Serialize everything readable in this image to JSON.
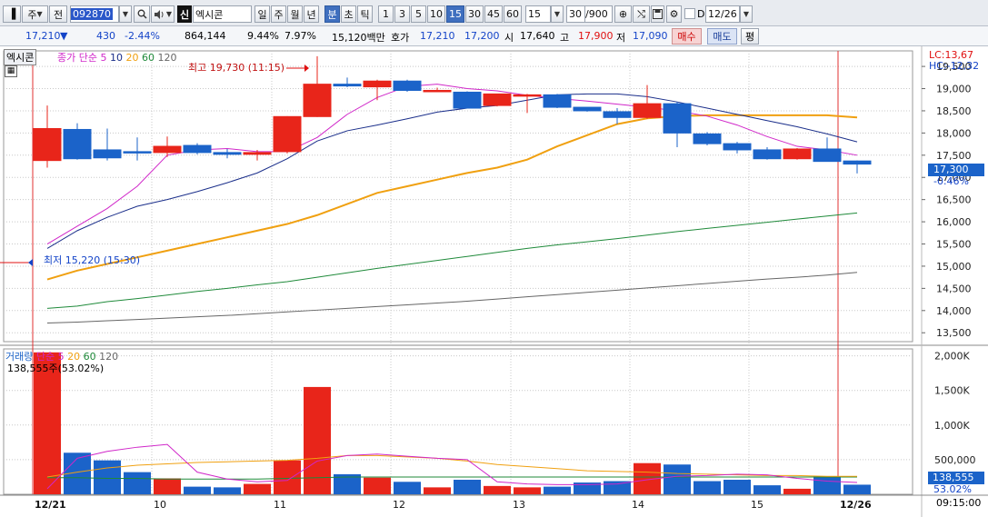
{
  "toolbar": {
    "market": "주",
    "segment": "전",
    "code": "092870",
    "credit_badge": "신",
    "name": "엑시콘",
    "periods": [
      "일",
      "주",
      "월",
      "년",
      "분",
      "초",
      "틱"
    ],
    "active_period": "분",
    "intervals": [
      "1",
      "3",
      "5",
      "10",
      "15",
      "30",
      "45",
      "60"
    ],
    "active_interval": "15",
    "interval_value": "15",
    "count": "30",
    "count_total": "/900",
    "date_check": "D",
    "date": "12/26"
  },
  "quote": {
    "price": "17,210",
    "arrow": "▼",
    "change": "430",
    "change_pct": "-2.44%",
    "volume": "864,144",
    "pct1": "9.44%",
    "pct2": "7.97%",
    "amount": "15,120백만",
    "ask_label": "호가",
    "ask": "17,210",
    "bid": "17,200",
    "open_label": "시",
    "open": "17,640",
    "high_label": "고",
    "high": "17,900",
    "low_label": "저",
    "low": "17,090",
    "buy_label": "매수",
    "sell_label": "매도",
    "flat_label": "평"
  },
  "price_panel": {
    "title": "엑시콘",
    "ma_label": "종가 단순",
    "ma_periods": [
      "5",
      "10",
      "20",
      "60",
      "120"
    ],
    "lc": "LC:13,67",
    "hc": "HC:-12,32",
    "high_note": "최고 19,730 (11:15)",
    "low_note": "최저 15,220 (15:30)",
    "current_price": "17,300",
    "current_pct": "-0.46%",
    "y_ticks": [
      "19,500",
      "19,000",
      "18,500",
      "18,000",
      "17,500",
      "17,000",
      "16,500",
      "16,000",
      "15,500",
      "15,000",
      "14,500",
      "14,000",
      "13,500"
    ]
  },
  "volume_panel": {
    "title": "거래량",
    "ma_label": "단순",
    "ma_periods": [
      "5",
      "20",
      "60",
      "120"
    ],
    "info": "138,555주(53.02%)",
    "y_ticks": [
      "2,000K",
      "1,500K",
      "1,000K",
      "500,000"
    ],
    "current_volume": "138,555",
    "current_pct": "53.02%"
  },
  "x_axis": {
    "labels": [
      "12/21",
      "10",
      "11",
      "12",
      "13",
      "14",
      "15",
      "12/26"
    ],
    "time": "09:15:00"
  },
  "colors": {
    "up": "#e8251a",
    "down": "#1b63c9",
    "ma5": "#d027c9",
    "ma10": "#1a2e8a",
    "ma20": "#f0a010",
    "ma60": "#1f8a3a",
    "ma120": "#666666"
  },
  "chart_data": {
    "type": "candlestick",
    "y_range": [
      13300,
      19850
    ],
    "volume_range": [
      0,
      2100000
    ],
    "candles": [
      {
        "o": 17380,
        "h": 18620,
        "l": 17220,
        "c": 18100,
        "v": 2050000
      },
      {
        "o": 18080,
        "h": 18220,
        "l": 17400,
        "c": 17420,
        "v": 600000
      },
      {
        "o": 17620,
        "h": 18100,
        "l": 17380,
        "c": 17440,
        "v": 490000
      },
      {
        "o": 17580,
        "h": 17900,
        "l": 17380,
        "c": 17560,
        "v": 320000
      },
      {
        "o": 17560,
        "h": 17920,
        "l": 17460,
        "c": 17700,
        "v": 230000
      },
      {
        "o": 17720,
        "h": 17770,
        "l": 17520,
        "c": 17560,
        "v": 110000
      },
      {
        "o": 17560,
        "h": 17640,
        "l": 17430,
        "c": 17520,
        "v": 100000
      },
      {
        "o": 17520,
        "h": 17620,
        "l": 17380,
        "c": 17560,
        "v": 150000
      },
      {
        "o": 17580,
        "h": 18380,
        "l": 17540,
        "c": 18370,
        "v": 490000
      },
      {
        "o": 18370,
        "h": 19730,
        "l": 18360,
        "c": 19100,
        "v": 1550000
      },
      {
        "o": 19100,
        "h": 19250,
        "l": 19030,
        "c": 19060,
        "v": 290000
      },
      {
        "o": 19040,
        "h": 19200,
        "l": 18740,
        "c": 19170,
        "v": 240000
      },
      {
        "o": 19170,
        "h": 19200,
        "l": 18930,
        "c": 18960,
        "v": 180000
      },
      {
        "o": 18960,
        "h": 19020,
        "l": 18920,
        "c": 18960,
        "v": 100000
      },
      {
        "o": 18920,
        "h": 18940,
        "l": 18560,
        "c": 18560,
        "v": 210000
      },
      {
        "o": 18620,
        "h": 18880,
        "l": 18600,
        "c": 18880,
        "v": 120000
      },
      {
        "o": 18840,
        "h": 18880,
        "l": 18450,
        "c": 18860,
        "v": 100000
      },
      {
        "o": 18860,
        "h": 18880,
        "l": 18560,
        "c": 18580,
        "v": 110000
      },
      {
        "o": 18580,
        "h": 18580,
        "l": 18480,
        "c": 18500,
        "v": 170000
      },
      {
        "o": 18480,
        "h": 18560,
        "l": 18200,
        "c": 18350,
        "v": 190000
      },
      {
        "o": 18350,
        "h": 19080,
        "l": 18320,
        "c": 18660,
        "v": 450000
      },
      {
        "o": 18660,
        "h": 18700,
        "l": 17680,
        "c": 18000,
        "v": 430000
      },
      {
        "o": 17980,
        "h": 18020,
        "l": 17720,
        "c": 17760,
        "v": 190000
      },
      {
        "o": 17760,
        "h": 17800,
        "l": 17540,
        "c": 17620,
        "v": 210000
      },
      {
        "o": 17620,
        "h": 17680,
        "l": 17400,
        "c": 17420,
        "v": 130000
      },
      {
        "o": 17420,
        "h": 17660,
        "l": 17400,
        "c": 17640,
        "v": 80000
      },
      {
        "o": 17640,
        "h": 17900,
        "l": 17360,
        "c": 17360,
        "v": 260000
      },
      {
        "o": 17370,
        "h": 17380,
        "l": 17090,
        "c": 17300,
        "v": 138555
      }
    ],
    "ma5": [
      15500,
      15900,
      16300,
      16800,
      17500,
      17620,
      17650,
      17580,
      17580,
      17900,
      18420,
      18800,
      19050,
      19100,
      19000,
      18950,
      18850,
      18780,
      18720,
      18650,
      18580,
      18500,
      18380,
      18180,
      17920,
      17700,
      17620,
      17500
    ],
    "ma10": [
      15400,
      15800,
      16100,
      16350,
      16500,
      16680,
      16880,
      17100,
      17420,
      17820,
      18050,
      18180,
      18320,
      18470,
      18560,
      18620,
      18740,
      18860,
      18880,
      18880,
      18820,
      18700,
      18560,
      18420,
      18280,
      18140,
      17980,
      17800
    ],
    "ma20": [
      14700,
      14900,
      15050,
      15200,
      15350,
      15500,
      15650,
      15800,
      15950,
      16150,
      16400,
      16650,
      16800,
      16950,
      17100,
      17220,
      17400,
      17700,
      17950,
      18200,
      18330,
      18380,
      18400,
      18400,
      18400,
      18400,
      18400,
      18350
    ],
    "ma60": [
      14050,
      14100,
      14200,
      14270,
      14350,
      14430,
      14500,
      14580,
      14650,
      14750,
      14850,
      14950,
      15040,
      15130,
      15220,
      15310,
      15400,
      15480,
      15550,
      15620,
      15700,
      15780,
      15850,
      15920,
      15990,
      16060,
      16130,
      16200
    ],
    "ma120": [
      13720,
      13740,
      13770,
      13800,
      13830,
      13860,
      13890,
      13930,
      13970,
      14010,
      14050,
      14090,
      14130,
      14170,
      14210,
      14260,
      14310,
      14360,
      14410,
      14460,
      14510,
      14560,
      14610,
      14660,
      14710,
      14750,
      14800,
      14860
    ],
    "vma5": [
      80000,
      520000,
      620000,
      680000,
      720000,
      320000,
      220000,
      180000,
      200000,
      480000,
      560000,
      580000,
      550000,
      520000,
      500000,
      180000,
      150000,
      140000,
      140000,
      150000,
      210000,
      260000,
      270000,
      290000,
      280000,
      230000,
      190000,
      170000
    ],
    "vma20": [
      250000,
      320000,
      380000,
      420000,
      440000,
      460000,
      470000,
      480000,
      490000,
      520000,
      560000,
      560000,
      540000,
      520000,
      480000,
      430000,
      400000,
      370000,
      340000,
      330000,
      320000,
      300000,
      290000,
      280000,
      270000,
      270000,
      260000,
      260000
    ],
    "vma60": [
      240000,
      240000,
      230000,
      230000,
      220000,
      220000,
      220000,
      220000,
      230000,
      240000,
      250000,
      250000,
      250000,
      250000,
      250000,
      250000,
      250000,
      250000,
      250000,
      250000,
      250000,
      250000,
      250000,
      250000,
      250000,
      250000,
      250000,
      250000
    ]
  }
}
